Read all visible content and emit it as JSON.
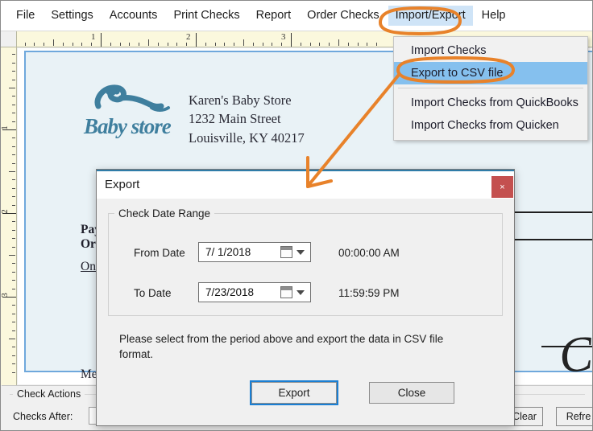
{
  "menubar": {
    "items": [
      {
        "label": "File",
        "active": false
      },
      {
        "label": "Settings",
        "active": false
      },
      {
        "label": "Accounts",
        "active": false
      },
      {
        "label": "Print Checks",
        "active": false
      },
      {
        "label": "Report",
        "active": false
      },
      {
        "label": "Order Checks",
        "active": false
      },
      {
        "label": "Import/Export",
        "active": true
      },
      {
        "label": "Help",
        "active": false
      }
    ]
  },
  "rulers": {
    "top_numbers": [
      "1",
      "2",
      "3"
    ],
    "left_numbers": [
      "1",
      "2",
      "3"
    ]
  },
  "check": {
    "logo_text": "Baby store",
    "company_name": "Karen's Baby Store",
    "address_line1": "1232 Main Street",
    "address_line2": "Louisville, KY 40217",
    "pay_to_line1": "Pay To The",
    "pay_to_line2": "Order Of",
    "amount_words": "One Hu",
    "memo_label": "Memo",
    "signature": "Cg"
  },
  "dropdown": {
    "items": [
      {
        "label": "Import Checks",
        "selected": false,
        "separator_after": false
      },
      {
        "label": "Export to CSV file",
        "selected": true,
        "separator_after": true
      },
      {
        "label": "Import Checks from QuickBooks",
        "selected": false,
        "separator_after": false
      },
      {
        "label": "Import Checks from Quicken",
        "selected": false,
        "separator_after": false
      }
    ]
  },
  "dialog": {
    "title": "Export",
    "close_icon_label": "×",
    "fieldset_legend": "Check Date Range",
    "from_date_label": "From Date",
    "from_date_value": "7/  1/2018",
    "from_time_value": "00:00:00 AM",
    "to_date_label": "To Date",
    "to_date_value": "7/23/2018",
    "to_time_value": "11:59:59 PM",
    "message": "Please select from the period above and export the data in CSV file format.",
    "export_button": "Export",
    "close_button": "Close"
  },
  "bottom_panel": {
    "group_legend": "Check Actions",
    "checks_after_label": "Checks After:",
    "checks_after_value": "",
    "clear_button": "Clear",
    "refresh_button": "Refre"
  },
  "colors": {
    "menu_highlight": "#cfe4f7",
    "dropdown_selected": "#85c0ee",
    "annotation_orange": "#e8822a",
    "dialog_close_red": "#c4504f",
    "check_paper": "#e9f2f6",
    "check_border_blue": "#6fa8dc",
    "ruler_yellow": "#fbf8dd",
    "focus_blue": "#1a7fd4"
  }
}
